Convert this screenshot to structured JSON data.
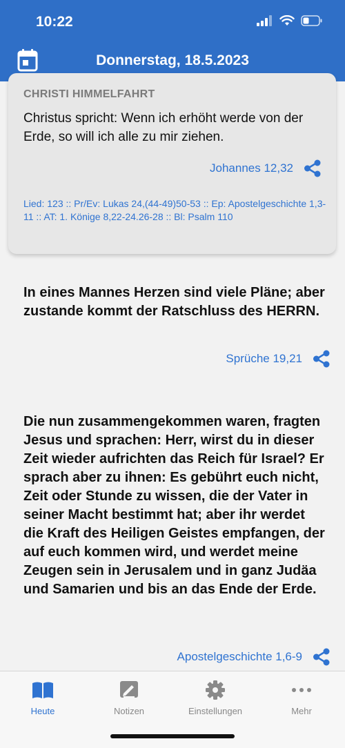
{
  "status": {
    "time": "10:22"
  },
  "header": {
    "title": "Donnerstag, 18.5.2023"
  },
  "card": {
    "feast": "CHRISTI HIMMELFAHRT",
    "text": "Christus spricht: Wenn ich erhöht werde von der Erde, so will ich alle zu mir ziehen.",
    "reference": "Johannes 12,32",
    "readings": "Lied: 123 :: Pr/Ev: Lukas 24,(44-49)50-53 :: Ep: Apostelgeschichte 1,3-11 :: AT: 1. Könige 8,22-24.26-28 :: Bl: Psalm 110"
  },
  "losung": {
    "text": "In eines Mannes Herzen sind viele Pläne; aber zustande kommt der Ratschluss des HERRN.",
    "reference": "Sprüche 19,21"
  },
  "lehrtext": {
    "text": "Die nun zusammengekommen waren, fragten Jesus und sprachen: Herr, wirst du in dieser Zeit wieder aufrichten das Reich für Israel? Er sprach aber zu ihnen: Es gebührt euch nicht, Zeit oder Stunde zu wissen, die der Vater in seiner Macht bestimmt hat; aber ihr werdet die Kraft des Heiligen Geistes empfangen, der auf euch kommen wird, und werdet meine Zeugen sein in Jerusalem und in ganz Judäa und Samarien und bis an das Ende der Erde.",
    "reference": "Apostelgeschichte 1,6-9"
  },
  "tabs": [
    {
      "label": "Heute",
      "icon": "book-icon",
      "active": true
    },
    {
      "label": "Notizen",
      "icon": "note-icon",
      "active": false
    },
    {
      "label": "Einstellungen",
      "icon": "gear-icon",
      "active": false
    },
    {
      "label": "Mehr",
      "icon": "more-icon",
      "active": false
    }
  ],
  "colors": {
    "primary": "#2f6fc7",
    "link": "#2f73d1",
    "background": "#f2f2f2",
    "card": "#e7e7e7"
  }
}
